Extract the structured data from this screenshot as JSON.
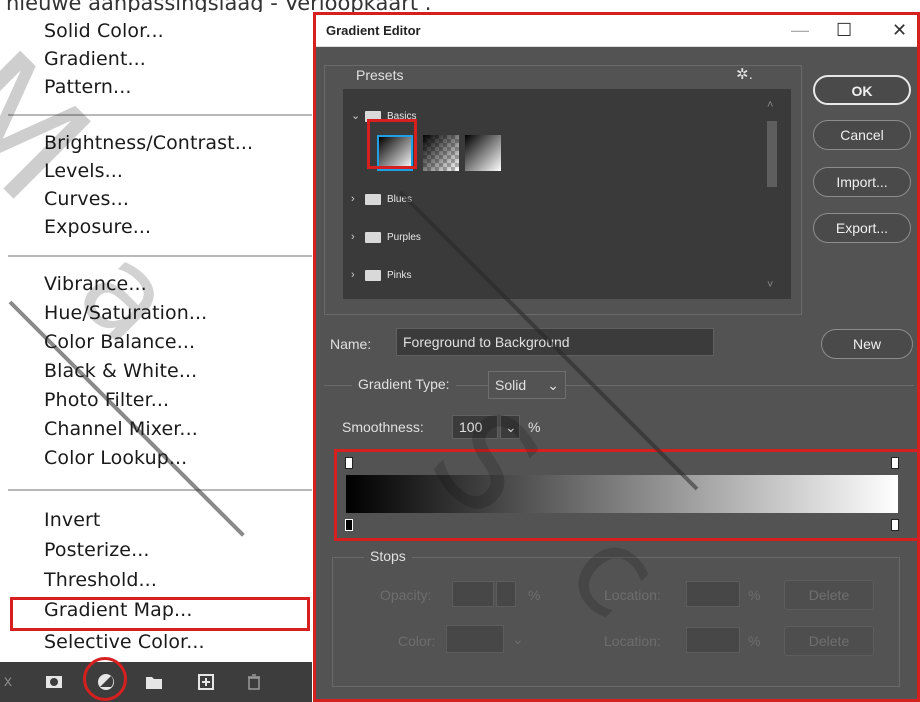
{
  "page": {
    "top_text": "nieuwe aanpassingslaag - Verloopkaart ."
  },
  "menu": {
    "items": [
      "Solid Color...",
      "Gradient...",
      "Pattern...",
      "Brightness/Contrast...",
      "Levels...",
      "Curves...",
      "Exposure...",
      "Vibrance...",
      "Hue/Saturation...",
      "Color Balance...",
      "Black & White...",
      "Photo Filter...",
      "Channel Mixer...",
      "Color Lookup...",
      "Invert",
      "Posterize...",
      "Threshold...",
      "Gradient Map...",
      "Selective Color..."
    ],
    "highlighted": "Gradient Map...",
    "toolbar_icons": [
      "link-icon",
      "mask-icon",
      "adjustment-icon",
      "folder-icon",
      "new-layer-icon",
      "trash-icon"
    ]
  },
  "dialog": {
    "title": "Gradient Editor",
    "presets_label": "Presets",
    "folders": [
      {
        "name": "Basics",
        "expanded": true
      },
      {
        "name": "Blues",
        "expanded": false
      },
      {
        "name": "Purples",
        "expanded": false
      },
      {
        "name": "Pinks",
        "expanded": false
      }
    ],
    "buttons": {
      "ok": "OK",
      "cancel": "Cancel",
      "import": "Import...",
      "export": "Export...",
      "new": "New"
    },
    "name_label": "Name:",
    "name_value": "Foreground to Background",
    "gradient_type_label": "Gradient Type:",
    "gradient_type_value": "Solid",
    "smoothness_label": "Smoothness:",
    "smoothness_value": "100",
    "smoothness_unit": "%",
    "stops": {
      "label": "Stops",
      "opacity_label": "Opacity:",
      "percent": "%",
      "location_label": "Location:",
      "delete_label": "Delete",
      "color_label": "Color:"
    }
  },
  "watermark": {
    "text": "Ma          Sc"
  },
  "colors": {
    "dialog_bg": "#535353",
    "panel_bg": "#3a3a3a",
    "highlight": "#d62020",
    "selected_swatch": "#1ea0e6"
  }
}
